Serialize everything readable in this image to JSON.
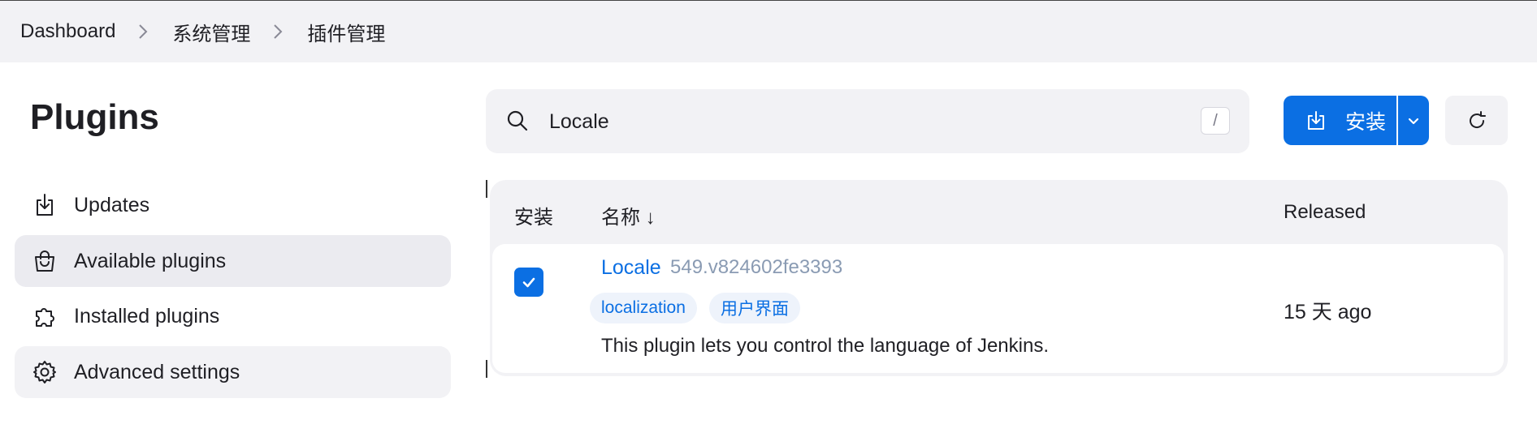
{
  "breadcrumb": {
    "items": [
      "Dashboard",
      "系统管理",
      "插件管理"
    ]
  },
  "page_title": "Plugins",
  "sidebar": {
    "items": [
      {
        "label": "Updates",
        "icon": "download-icon"
      },
      {
        "label": "Available plugins",
        "icon": "shopping-bag-icon"
      },
      {
        "label": "Installed plugins",
        "icon": "puzzle-icon"
      },
      {
        "label": "Advanced settings",
        "icon": "gear-icon"
      }
    ]
  },
  "search": {
    "value": "Locale",
    "shortcut": "/"
  },
  "toolbar": {
    "install_label": "安装"
  },
  "table": {
    "headers": {
      "install": "安装",
      "name": "名称 ↓",
      "released": "Released"
    },
    "rows": [
      {
        "checked": true,
        "name": "Locale",
        "version": "549.v824602fe3393",
        "tags": [
          "localization",
          "用户界面"
        ],
        "description": "This plugin lets you control the language of Jenkins.",
        "released": "15 天 ago"
      }
    ]
  },
  "colors": {
    "accent": "#0b6fe3",
    "panel": "#f2f2f5"
  }
}
